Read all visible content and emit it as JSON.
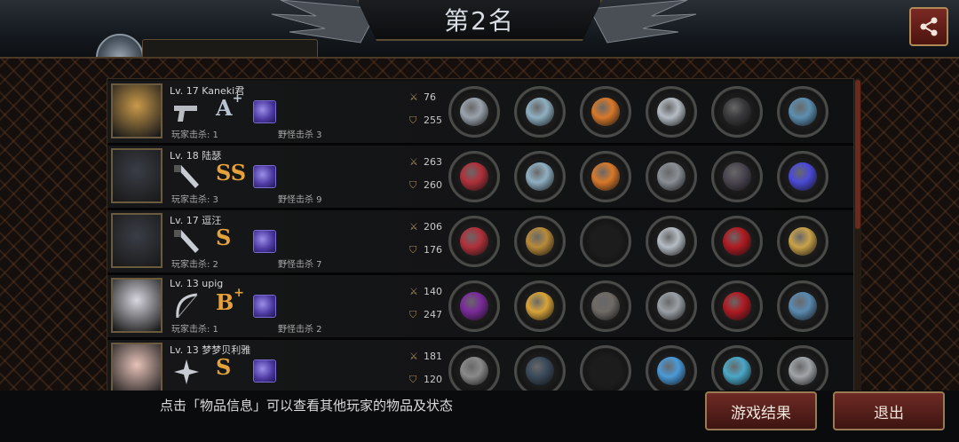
{
  "header": {
    "rank_title": "第2名",
    "share_icon": "share-icon"
  },
  "players": [
    {
      "level_name": "Lv. 17 Kaneki君",
      "weapon": "pistol-icon",
      "grade": "A",
      "grade_sup": "+",
      "grade_color": "#b9c4d2",
      "player_kills": "玩家击杀: 1",
      "monster_kills": "野怪击杀 3",
      "atk": "76",
      "def": "255",
      "portrait_color": "#c99a4a",
      "items": [
        "claw-blade-icon",
        "steel-helmet-icon",
        "flame-armor-icon",
        "silver-bracer-icon",
        "black-boots-icon",
        "blue-orb-icon"
      ]
    },
    {
      "level_name": "Lv. 18 陆瑟",
      "weapon": "knife-icon",
      "grade": "SS",
      "grade_sup": "",
      "grade_color": "#e5a23a",
      "player_kills": "玩家击杀: 3",
      "monster_kills": "野怪击杀 9",
      "atk": "263",
      "def": "260",
      "portrait_color": "#3a3d46",
      "items": [
        "crimson-sword-icon",
        "steel-helmet-icon",
        "flame-armor-icon",
        "spiked-gauntlet-icon",
        "dark-boots-icon",
        "galaxy-orb-icon"
      ]
    },
    {
      "level_name": "Lv. 17 逗汪",
      "weapon": "knife-icon",
      "grade": "S",
      "grade_sup": "",
      "grade_color": "#e5a23a",
      "player_kills": "玩家击杀: 2",
      "monster_kills": "野怪击杀 7",
      "atk": "206",
      "def": "176",
      "portrait_color": "#3a3d46",
      "items": [
        "crimson-sword-icon",
        "gold-helmet-icon",
        "empty-slot",
        "silver-bracer-icon",
        "red-heels-icon",
        "gold-box-icon"
      ]
    },
    {
      "level_name": "Lv. 13 upig",
      "weapon": "bow-icon",
      "grade": "B",
      "grade_sup": "+",
      "grade_color": "#e5a23a",
      "player_kills": "玩家击杀: 1",
      "monster_kills": "野怪击杀 2",
      "atk": "140",
      "def": "247",
      "portrait_color": "#d8d6df",
      "items": [
        "purple-bow-icon",
        "gold-tiara-icon",
        "stone-armor-icon",
        "wrist-watch-icon",
        "red-heels-icon",
        "quiver-icon"
      ]
    },
    {
      "level_name": "Lv. 13 梦梦贝利雅",
      "weapon": "shuriken-icon",
      "grade": "S",
      "grade_sup": "",
      "grade_color": "#e5a23a",
      "player_kills": "",
      "monster_kills": "",
      "atk": "181",
      "def": "120",
      "portrait_color": "#e6c2b8",
      "items": [
        "katana-icon",
        "dark-helmet-icon",
        "empty-slot",
        "blue-necklace-icon",
        "blue-sneakers-icon",
        "steel-plate-icon"
      ]
    }
  ],
  "item_colors": {
    "claw-blade-icon": "#9aa3ad",
    "steel-helmet-icon": "#8fb0c2",
    "flame-armor-icon": "#d8782a",
    "silver-bracer-icon": "#b5bcc4",
    "black-boots-icon": "#3a3a3c",
    "blue-orb-icon": "#5c8fb0",
    "crimson-sword-icon": "#b0303a",
    "spiked-gauntlet-icon": "#8a8f96",
    "dark-boots-icon": "#4a4550",
    "galaxy-orb-icon": "#4a4ad8",
    "gold-helmet-icon": "#b88a3a",
    "empty-slot": "#0b0b0b",
    "red-heels-icon": "#b01a22",
    "gold-box-icon": "#c9a24a",
    "purple-bow-icon": "#7a2a9a",
    "gold-tiara-icon": "#d8a43a",
    "stone-armor-icon": "#6e6a66",
    "wrist-watch-icon": "#9aa0a6",
    "quiver-icon": "#5a8ab0",
    "katana-icon": "#8a8a8a",
    "dark-helmet-icon": "#3a4a5a",
    "blue-necklace-icon": "#4a9ad8",
    "blue-sneakers-icon": "#4aa8c8",
    "steel-plate-icon": "#a0a4a8"
  },
  "footer": {
    "tip": "点击「物品信息」可以查看其他玩家的物品及状态",
    "result_button": "游戏结果",
    "exit_button": "退出"
  }
}
